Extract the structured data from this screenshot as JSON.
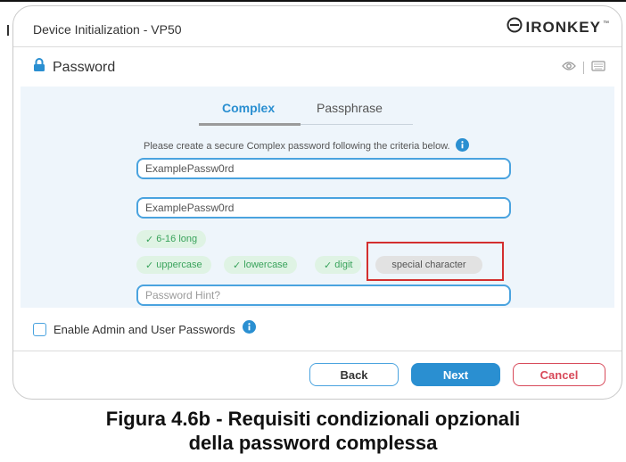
{
  "window": {
    "title": "Device Initialization - VP50",
    "logo_text": "IRONKEY",
    "logo_tm": "™"
  },
  "section": {
    "title": "Password",
    "icons": [
      "lock-icon",
      "eye-icon",
      "keyboard-icon"
    ]
  },
  "tabs": [
    {
      "label": "Complex",
      "active": true
    },
    {
      "label": "Passphrase",
      "active": false
    }
  ],
  "instruction": "Please create a secure Complex password following the criteria below.",
  "fields": {
    "password_value": "ExamplePassw0rd",
    "confirm_value": "ExamplePassw0rd",
    "hint_placeholder": "Password Hint?"
  },
  "criteria": [
    {
      "label": "6-16 long",
      "met": true
    },
    {
      "label": "uppercase",
      "met": true
    },
    {
      "label": "lowercase",
      "met": true
    },
    {
      "label": "digit",
      "met": true
    },
    {
      "label": "special character",
      "met": false
    }
  ],
  "criteria_check": "✓",
  "admin": {
    "label": "Enable Admin and User Passwords",
    "checked": false
  },
  "buttons": {
    "back": "Back",
    "next": "Next",
    "cancel": "Cancel"
  },
  "caption": {
    "line1": "Figura 4.6b - Requisiti condizionali opzionali",
    "line2": "della password complessa"
  },
  "colors": {
    "accent": "#2a8fd1",
    "met": "#3aa35c",
    "cancel": "#d84a5a",
    "highlight": "#d32f2f"
  }
}
